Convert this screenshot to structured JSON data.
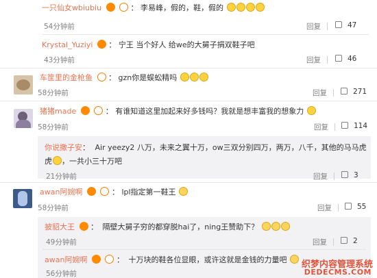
{
  "reply_label": "回复",
  "comments": [
    {
      "username": "一只仙女wbiubiu",
      "text": "李易峰，假的，鞋，假的",
      "time": "54分钟前",
      "likes": "47"
    },
    {
      "username": "Krystal_Yuziyi",
      "text": "宁王 当个好人 给we的大舅子捐双鞋子吧",
      "time": "43分钟前",
      "likes": "46"
    },
    {
      "username": "车筐里的金枪鱼",
      "text": "gzn你是蜈蚣精吗",
      "time": "58分钟前",
      "likes": "271"
    },
    {
      "username": "猪猪made",
      "text": "有谁知道这里加起来好多钱吗？我就是想丰富我的想象力",
      "time": "58分钟前",
      "likes": "114"
    },
    {
      "username": "你说撒子安",
      "text_line1": "Air yeezy2 八万，未来之翼十万，ow三双分别四万，两万，八千，其他的马马虎",
      "text_line2_a": "虎",
      "text_line2_b": "，一共小三十万吧",
      "time": "21分钟前",
      "likes": "3"
    },
    {
      "username": "awan阿婉啊",
      "text": "lpl指定第一鞋王",
      "time": "58分钟前",
      "likes": "55"
    },
    {
      "username": "披貂大王",
      "text": "隔壁大舅子穷的都穿脱hai了，ning王赞助下？",
      "time": "49分钟前",
      "likes": "2"
    },
    {
      "username": "awan阿婉啊",
      "text": "十万块的鞋各位显眼，或许这就是金钱的力量吧",
      "time": "56分钟前",
      "likes": ""
    }
  ],
  "watermark": {
    "line1": "织梦内容管理系统",
    "line2": "DEDECMS.COM"
  },
  "colors": {
    "username": "#eb7350",
    "subbox": "#f2f2f5",
    "meta_text": "#808080"
  }
}
